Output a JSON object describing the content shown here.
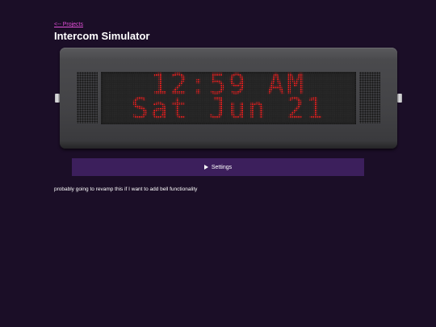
{
  "nav": {
    "back_label": "<-- Projects"
  },
  "header": {
    "title": "Intercom Simulator"
  },
  "display": {
    "line1": "12:59 AM",
    "line2": "Sat Jun 21",
    "led_color": "#ff1f1f"
  },
  "settings": {
    "label": "Settings",
    "expanded": false,
    "icon": "triangle-right-icon"
  },
  "note": {
    "text": "probably going to revamp this if I want to add bell functionality"
  },
  "colors": {
    "background": "#1b0e27",
    "link": "#e04fd6",
    "settings_bar": "#3c1f5c"
  }
}
